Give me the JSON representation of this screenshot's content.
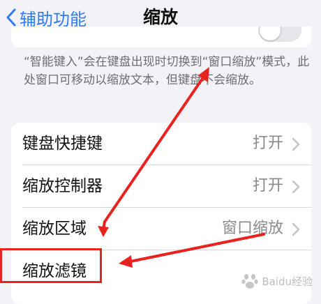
{
  "navbar": {
    "back_label": "辅助功能",
    "title": "缩放"
  },
  "footnote": {
    "text": "“智能键入”会在键盘出现时切换到“窗口缩放”模式，此处窗口可移动以缩放文本，但键盘不会缩放。"
  },
  "settings": {
    "rows": [
      {
        "label": "键盘快捷键",
        "value": "打开"
      },
      {
        "label": "缩放控制器",
        "value": "打开"
      },
      {
        "label": "缩放区域",
        "value": "窗口缩放"
      },
      {
        "label": "缩放滤镜",
        "value": ""
      }
    ]
  },
  "annotations": {
    "color": "#e8231f"
  },
  "watermark": {
    "text": "Baidu经验"
  },
  "colors": {
    "accent": "#2f7bf6",
    "background": "#f2f2f7"
  }
}
